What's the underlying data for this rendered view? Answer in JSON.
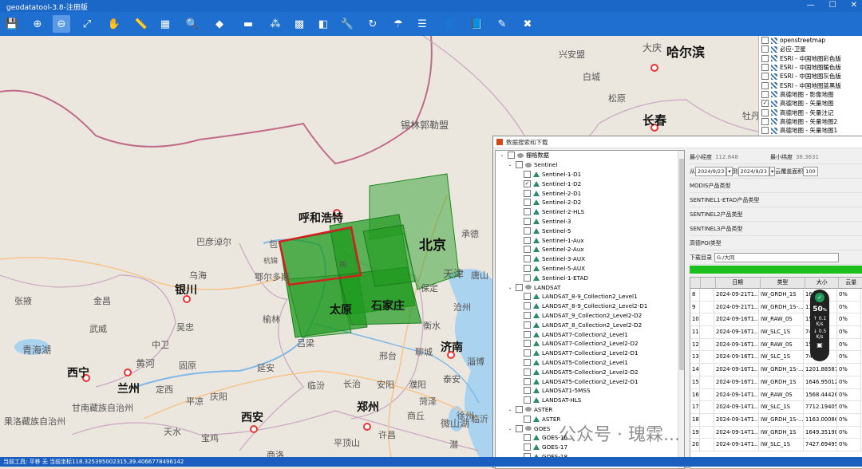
{
  "window": {
    "title": "geodatatool-3.8-注册版",
    "minimize": "—",
    "maximize": "☐",
    "close": "✕"
  },
  "toolbar": {
    "buttons": [
      {
        "icon": "save-icon",
        "glyph": "💾"
      },
      {
        "icon": "zoom-in-icon",
        "glyph": "⊕"
      },
      {
        "icon": "zoom-out-icon",
        "glyph": "⊖"
      },
      {
        "icon": "full-extent-icon",
        "glyph": "⤢"
      },
      {
        "icon": "pan-hand-icon",
        "glyph": "✋"
      },
      {
        "icon": "measure-icon",
        "glyph": "📏"
      },
      {
        "icon": "area-measure-icon",
        "glyph": "▦"
      },
      {
        "icon": "search-icon",
        "glyph": "🔍"
      },
      {
        "icon": "locate-icon",
        "glyph": "◆"
      },
      {
        "icon": "draw-rect-icon",
        "glyph": "▬"
      },
      {
        "icon": "select-icon",
        "glyph": "⁂"
      },
      {
        "icon": "grid-icon",
        "glyph": "▩"
      },
      {
        "icon": "clear-icon",
        "glyph": "◧"
      },
      {
        "icon": "tools-icon",
        "glyph": "🔧"
      },
      {
        "icon": "refresh-icon",
        "glyph": "↻"
      },
      {
        "icon": "satellite-icon",
        "glyph": "☂"
      },
      {
        "icon": "layers-icon",
        "glyph": "☰"
      },
      {
        "icon": "user-icon",
        "glyph": "👤"
      },
      {
        "icon": "book-icon",
        "glyph": "📘"
      },
      {
        "icon": "edit-icon",
        "glyph": "✎"
      },
      {
        "icon": "exit-icon",
        "glyph": "✖"
      }
    ]
  },
  "map": {
    "labels": [
      {
        "text": "大庆",
        "size": 12,
        "bold": false
      },
      {
        "text": "哈尔滨",
        "size": 16,
        "bold": true
      },
      {
        "text": "兴安盟",
        "size": 11,
        "bold": false
      },
      {
        "text": "白城",
        "size": 11,
        "bold": false
      },
      {
        "text": "松原",
        "size": 11,
        "bold": false
      },
      {
        "text": "长春",
        "size": 15,
        "bold": true
      },
      {
        "text": "锡林郭勒盟",
        "size": 12,
        "bold": false
      },
      {
        "text": "呼和浩特",
        "size": 14,
        "bold": true
      },
      {
        "text": "北京",
        "size": 17,
        "bold": true
      },
      {
        "text": "巴彦淖尔",
        "size": 11,
        "bold": false
      },
      {
        "text": "包",
        "size": 11,
        "bold": false
      },
      {
        "text": "鄂尔多斯",
        "size": 11,
        "bold": false
      },
      {
        "text": "银川",
        "size": 14,
        "bold": true
      },
      {
        "text": "乌海",
        "size": 11,
        "bold": false
      },
      {
        "text": "张掖",
        "size": 11,
        "bold": false
      },
      {
        "text": "金昌",
        "size": 11,
        "bold": false
      },
      {
        "text": "武威",
        "size": 11,
        "bold": false
      },
      {
        "text": "吴忠",
        "size": 11,
        "bold": false
      },
      {
        "text": "中卫",
        "size": 11,
        "bold": false
      },
      {
        "text": "青海湖",
        "size": 12,
        "bold": false
      },
      {
        "text": "西宁",
        "size": 14,
        "bold": true
      },
      {
        "text": "兰州",
        "size": 14,
        "bold": true
      },
      {
        "text": "黄河",
        "size": 12,
        "bold": false
      },
      {
        "text": "固原",
        "size": 11,
        "bold": false
      },
      {
        "text": "定西",
        "size": 11,
        "bold": false
      },
      {
        "text": "庆阳",
        "size": 11,
        "bold": false
      },
      {
        "text": "平凉",
        "size": 11,
        "bold": false
      },
      {
        "text": "甘南藏族自治州",
        "size": 11,
        "bold": false
      },
      {
        "text": "西安",
        "size": 14,
        "bold": true
      },
      {
        "text": "延安",
        "size": 11,
        "bold": false
      },
      {
        "text": "榆林",
        "size": 11,
        "bold": false
      },
      {
        "text": "吕梁",
        "size": 11,
        "bold": false
      },
      {
        "text": "太原",
        "size": 14,
        "bold": true
      },
      {
        "text": "石家庄",
        "size": 14,
        "bold": true
      },
      {
        "text": "天津",
        "size": 13,
        "bold": false
      },
      {
        "text": "承德",
        "size": 11,
        "bold": false
      },
      {
        "text": "唐山",
        "size": 11,
        "bold": false
      },
      {
        "text": "保定",
        "size": 11,
        "bold": false
      },
      {
        "text": "沧州",
        "size": 11,
        "bold": false
      },
      {
        "text": "衡水",
        "size": 11,
        "bold": false
      },
      {
        "text": "邢台",
        "size": 11,
        "bold": false
      },
      {
        "text": "聊城",
        "size": 11,
        "bold": false
      },
      {
        "text": "济南",
        "size": 14,
        "bold": true
      },
      {
        "text": "淄博",
        "size": 11,
        "bold": false
      },
      {
        "text": "临汾",
        "size": 11,
        "bold": false
      },
      {
        "text": "长治",
        "size": 11,
        "bold": false
      },
      {
        "text": "安阳",
        "size": 11,
        "bold": false
      },
      {
        "text": "濮阳",
        "size": 11,
        "bold": false
      },
      {
        "text": "泰安",
        "size": 11,
        "bold": false
      },
      {
        "text": "郑州",
        "size": 14,
        "bold": true
      },
      {
        "text": "菏泽",
        "size": 11,
        "bold": false
      },
      {
        "text": "商丘",
        "size": 11,
        "bold": false
      },
      {
        "text": "徐州",
        "size": 11,
        "bold": false
      },
      {
        "text": "微山湖",
        "size": 12,
        "bold": false
      },
      {
        "text": "临沂",
        "size": 11,
        "bold": false
      },
      {
        "text": "天水",
        "size": 11,
        "bold": false
      },
      {
        "text": "宝鸡",
        "size": 11,
        "bold": false
      },
      {
        "text": "平顶山",
        "size": 11,
        "bold": false
      },
      {
        "text": "许昌",
        "size": 11,
        "bold": false
      },
      {
        "text": "商洛",
        "size": 11,
        "bold": false
      },
      {
        "text": "果洛藏族自治州",
        "size": 11,
        "bold": false
      },
      {
        "text": "牡丹",
        "size": 11,
        "bold": false
      },
      {
        "text": "杭锦",
        "size": 9,
        "bold": false
      },
      {
        "text": "朔",
        "size": 9,
        "bold": false
      },
      {
        "text": "潜",
        "size": 11,
        "bold": false
      }
    ]
  },
  "layers": [
    {
      "name": "openstreetmap",
      "checked": false
    },
    {
      "name": "必应-卫星",
      "checked": false
    },
    {
      "name": "ESRI - 中国地图彩色版",
      "checked": false
    },
    {
      "name": "ESRI - 中国地图暖色版",
      "checked": false
    },
    {
      "name": "ESRI - 中国地图灰色版",
      "checked": false
    },
    {
      "name": "ESRI - 中国地图蓝黑版",
      "checked": false
    },
    {
      "name": "高德地图 - 影像地图",
      "checked": false
    },
    {
      "name": "高德地图 - 矢量地图",
      "checked": true
    },
    {
      "name": "高德地图 - 矢量注记",
      "checked": false
    },
    {
      "name": "高德地图 - 矢量地图2",
      "checked": false
    },
    {
      "name": "高德地图 - 矢量地图1",
      "checked": false
    }
  ],
  "dialog": {
    "title": "数据搜索和下载",
    "tree": [
      {
        "level": 0,
        "label": "栅格数据",
        "toggle": "⌄",
        "kind": "group",
        "checked": false
      },
      {
        "level": 1,
        "label": "Sentinel",
        "toggle": "⌄",
        "kind": "group",
        "checked": false
      },
      {
        "level": 2,
        "label": "Sentinel-1-D1",
        "checked": false,
        "kind": "item"
      },
      {
        "level": 2,
        "label": "Sentinel-1-D2",
        "checked": true,
        "kind": "item"
      },
      {
        "level": 2,
        "label": "Sentinel-2-D1",
        "checked": false,
        "kind": "item"
      },
      {
        "level": 2,
        "label": "Sentinel-2-D2",
        "checked": false,
        "kind": "item"
      },
      {
        "level": 2,
        "label": "Sentinel-2-HLS",
        "checked": false,
        "kind": "item"
      },
      {
        "level": 2,
        "label": "Sentinel-3",
        "checked": false,
        "kind": "item"
      },
      {
        "level": 2,
        "label": "Sentinel-5",
        "checked": false,
        "kind": "item"
      },
      {
        "level": 2,
        "label": "Sentinel-1-Aux",
        "checked": false,
        "kind": "item"
      },
      {
        "level": 2,
        "label": "Sentinel-2-Aux",
        "checked": false,
        "kind": "item"
      },
      {
        "level": 2,
        "label": "Sentinel-3-AUX",
        "checked": false,
        "kind": "item"
      },
      {
        "level": 2,
        "label": "Sentinel-5-AUX",
        "checked": false,
        "kind": "item"
      },
      {
        "level": 2,
        "label": "Sentinel-1-ETAD",
        "checked": false,
        "kind": "item"
      },
      {
        "level": 1,
        "label": "LANDSAT",
        "toggle": "⌄",
        "kind": "group",
        "checked": false
      },
      {
        "level": 2,
        "label": "LANDSAT_8-9_Collection2_Level1",
        "checked": false,
        "kind": "item"
      },
      {
        "level": 2,
        "label": "LANDSAT_8-9_Collection2_Level2-D1",
        "checked": false,
        "kind": "item"
      },
      {
        "level": 2,
        "label": "LANDSAT_9_Collection2_Level2-D2",
        "checked": false,
        "kind": "item"
      },
      {
        "level": 2,
        "label": "LANDSAT_8_Collection2_Level2-D2",
        "checked": false,
        "kind": "item"
      },
      {
        "level": 2,
        "label": "LANDSAT7-Collection2_Level1",
        "checked": false,
        "kind": "item"
      },
      {
        "level": 2,
        "label": "LANDSAT7-Collection2_Level2-D2",
        "checked": false,
        "kind": "item"
      },
      {
        "level": 2,
        "label": "LANDSAT7-Collection2_Level2-D1",
        "checked": false,
        "kind": "item"
      },
      {
        "level": 2,
        "label": "LANDSAT5-Collection2_Level1",
        "checked": false,
        "kind": "item"
      },
      {
        "level": 2,
        "label": "LANDSAT5-Collection2_Level2-D2",
        "checked": false,
        "kind": "item"
      },
      {
        "level": 2,
        "label": "LANDSAT5-Collection2_Level2-D1",
        "checked": false,
        "kind": "item"
      },
      {
        "level": 2,
        "label": "LANDSAT1-5MSS",
        "checked": false,
        "kind": "item"
      },
      {
        "level": 2,
        "label": "LANDSAT-HLS",
        "checked": false,
        "kind": "item"
      },
      {
        "level": 1,
        "label": "ASTER",
        "toggle": "⌄",
        "kind": "group",
        "checked": false
      },
      {
        "level": 2,
        "label": "ASTER",
        "checked": false,
        "kind": "item"
      },
      {
        "level": 1,
        "label": "GOES",
        "toggle": "⌄",
        "kind": "group",
        "checked": false
      },
      {
        "level": 2,
        "label": "GOES-16",
        "checked": false,
        "kind": "item"
      },
      {
        "level": 2,
        "label": "GOES-17",
        "checked": false,
        "kind": "item"
      },
      {
        "level": 2,
        "label": "GOES-18",
        "checked": false,
        "kind": "item"
      }
    ],
    "form": {
      "min_lon_label": "最小经度",
      "min_lon": "112.848",
      "min_lat_label": "最小纬度",
      "min_lat": "38.3631",
      "from_label": "从",
      "from_date": "2024/9/23",
      "to_label": "到",
      "to_date": "2024/9/23",
      "cloud_label": "云覆盖面积",
      "cloud_value": "100",
      "modis_label": "MODIS产品类型",
      "s1_etad_label": "SENTINEL1-ETAD产品类型",
      "s2_label": "SENTINEL2产品类型",
      "s3_label": "SENTINEL3产品类型",
      "poi_label": "高德POI类型",
      "dir_label": "下载目录",
      "dir_value": "G:/大同"
    },
    "progress": 1.0,
    "table": {
      "headers": [
        "",
        "",
        "日期",
        "类型",
        "大小",
        "云量"
      ],
      "rows": [
        [
          "8",
          "",
          "2024-09-21T1...",
          "IW_GRDH_1S",
          "1646...",
          "0%"
        ],
        [
          "9",
          "",
          "2024-09-21T1...",
          "IW_GRDH_1S-...",
          "1189...",
          "0%"
        ],
        [
          "10",
          "",
          "2024-09-16T1...",
          "IW_RAW_0S",
          "1556...",
          "0%"
        ],
        [
          "11",
          "",
          "2024-09-16T1...",
          "IW_SLC_1S",
          "7409...",
          "0%"
        ],
        [
          "12",
          "",
          "2024-09-16T1...",
          "IW_RAW_0S",
          "1556...",
          "0%"
        ],
        [
          "13",
          "",
          "2024-09-16T1...",
          "IW_SLC_1S",
          "7409...",
          "0%"
        ],
        [
          "14",
          "",
          "2024-09-16T1...",
          "IW_GRDH_1S-...",
          "1201.885870(...",
          "0%"
        ],
        [
          "15",
          "",
          "2024-09-16T1...",
          "IW_GRDH_1S",
          "1646.950122(...",
          "0%"
        ],
        [
          "16",
          "",
          "2024-09-14T1...",
          "IW_RAW_0S",
          "1568.444267(...",
          "0%"
        ],
        [
          "17",
          "",
          "2024-09-14T1...",
          "IW_SLC_1S",
          "7712.194057(...",
          "0%"
        ],
        [
          "18",
          "",
          "2024-09-14T1...",
          "IW_GRDH_1S-...",
          "1163.000865(...",
          "0%"
        ],
        [
          "19",
          "",
          "2024-09-14T1...",
          "IW_GRDH_1S",
          "1649.351980(...",
          "0%"
        ],
        [
          "20",
          "",
          "2024-09-14T1...",
          "IW_SLC_1S",
          "7427.694954(...",
          "0%"
        ]
      ]
    }
  },
  "speed_widget": {
    "percent": "50",
    "up_value": "0.1",
    "up_unit": "K/s",
    "down_value": "0.5",
    "down_unit": "K/s"
  },
  "status": "当前工具: 平移 无 当前坐标118.325395002315,39.4066778496142",
  "watermark": "公众号 · 瑰霖...",
  "colors": {
    "titlebar": "#1a67c7",
    "toolbar": "#1e6fd0",
    "footprint_fill": "#1e9a1e",
    "selected_outline": "#d02020",
    "progress": "#1ec01e"
  }
}
